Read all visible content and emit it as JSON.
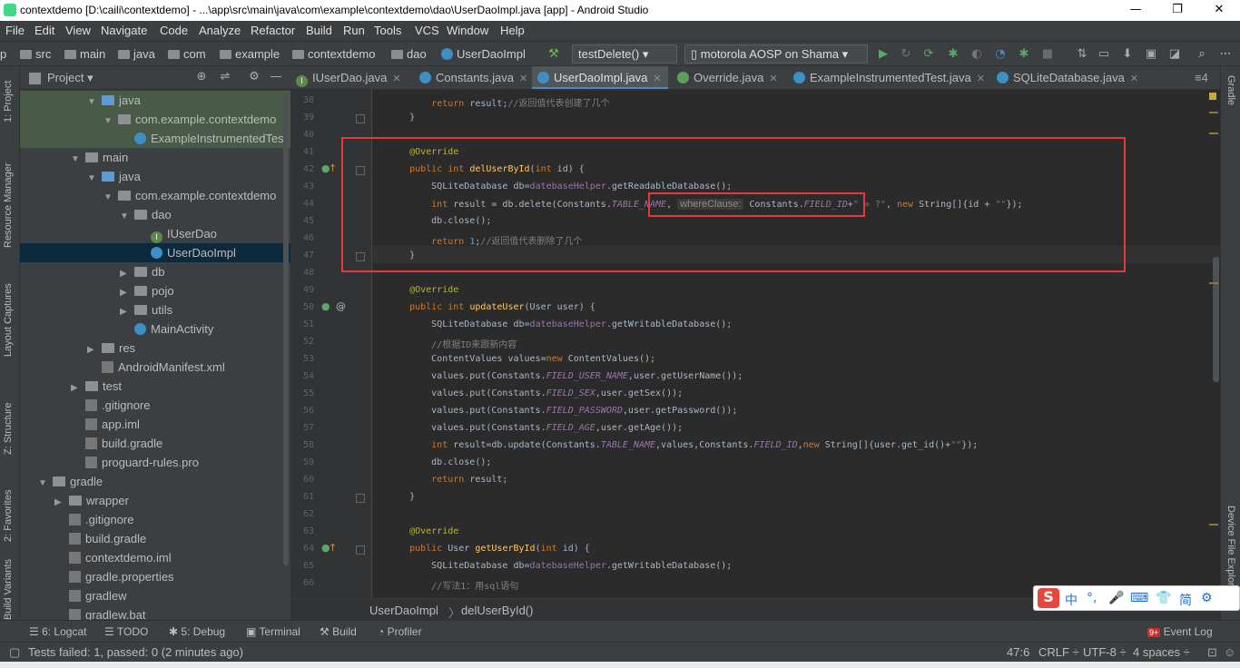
{
  "window": {
    "title": "contextdemo [D:\\caili\\contextdemo] - ...\\app\\src\\main\\java\\com\\example\\contextdemo\\dao\\UserDaoImpl.java [app] - Android Studio",
    "minimize": "—",
    "maximize": "❐",
    "close": "✕"
  },
  "menu": [
    "File",
    "Edit",
    "View",
    "Navigate",
    "Code",
    "Analyze",
    "Refactor",
    "Build",
    "Run",
    "Tools",
    "VCS",
    "Window",
    "Help"
  ],
  "nav": {
    "crumbs": [
      "p",
      "src",
      "main",
      "java",
      "com",
      "example",
      "contextdemo",
      "dao",
      "UserDaoImpl"
    ],
    "run_config": "testDelete()",
    "device": "motorola AOSP on Shama"
  },
  "project": {
    "title": "Project",
    "dropdown": "▾",
    "tree": [
      {
        "label": "java",
        "indent": 4,
        "icon": "folder-blue",
        "arrow": "▼",
        "state": "hl"
      },
      {
        "label": "com.example.contextdemo",
        "indent": 5,
        "icon": "folder",
        "arrow": "▼",
        "state": "hl"
      },
      {
        "label": "ExampleInstrumentedTest",
        "indent": 6,
        "icon": "class",
        "arrow": "",
        "state": "hl"
      },
      {
        "label": "main",
        "indent": 3,
        "icon": "folder",
        "arrow": "▼",
        "state": ""
      },
      {
        "label": "java",
        "indent": 4,
        "icon": "folder-blue",
        "arrow": "▼",
        "state": ""
      },
      {
        "label": "com.example.contextdemo",
        "indent": 5,
        "icon": "folder",
        "arrow": "▼",
        "state": ""
      },
      {
        "label": "dao",
        "indent": 6,
        "icon": "folder",
        "arrow": "▼",
        "state": ""
      },
      {
        "label": "IUserDao",
        "indent": 7,
        "icon": "interface",
        "arrow": "",
        "state": ""
      },
      {
        "label": "UserDaoImpl",
        "indent": 7,
        "icon": "class",
        "arrow": "",
        "state": "sel"
      },
      {
        "label": "db",
        "indent": 6,
        "icon": "folder",
        "arrow": "▶",
        "state": ""
      },
      {
        "label": "pojo",
        "indent": 6,
        "icon": "folder",
        "arrow": "▶",
        "state": ""
      },
      {
        "label": "utils",
        "indent": 6,
        "icon": "folder",
        "arrow": "▶",
        "state": ""
      },
      {
        "label": "MainActivity",
        "indent": 6,
        "icon": "class",
        "arrow": "",
        "state": ""
      },
      {
        "label": "res",
        "indent": 4,
        "icon": "folder",
        "arrow": "▶",
        "state": ""
      },
      {
        "label": "AndroidManifest.xml",
        "indent": 4,
        "icon": "file",
        "arrow": "",
        "state": ""
      },
      {
        "label": "test",
        "indent": 3,
        "icon": "folder",
        "arrow": "▶",
        "state": ""
      },
      {
        "label": ".gitignore",
        "indent": 3,
        "icon": "file",
        "arrow": "",
        "state": ""
      },
      {
        "label": "app.iml",
        "indent": 3,
        "icon": "file",
        "arrow": "",
        "state": ""
      },
      {
        "label": "build.gradle",
        "indent": 3,
        "icon": "file",
        "arrow": "",
        "state": ""
      },
      {
        "label": "proguard-rules.pro",
        "indent": 3,
        "icon": "file",
        "arrow": "",
        "state": ""
      },
      {
        "label": "gradle",
        "indent": 1,
        "icon": "folder",
        "arrow": "▼",
        "state": ""
      },
      {
        "label": "wrapper",
        "indent": 2,
        "icon": "folder",
        "arrow": "▶",
        "state": ""
      },
      {
        "label": ".gitignore",
        "indent": 2,
        "icon": "file",
        "arrow": "",
        "state": ""
      },
      {
        "label": "build.gradle",
        "indent": 2,
        "icon": "file",
        "arrow": "",
        "state": ""
      },
      {
        "label": "contextdemo.iml",
        "indent": 2,
        "icon": "file",
        "arrow": "",
        "state": ""
      },
      {
        "label": "gradle.properties",
        "indent": 2,
        "icon": "file",
        "arrow": "",
        "state": ""
      },
      {
        "label": "gradlew",
        "indent": 2,
        "icon": "file",
        "arrow": "",
        "state": ""
      },
      {
        "label": "gradlew.bat",
        "indent": 2,
        "icon": "file",
        "arrow": "",
        "state": ""
      }
    ]
  },
  "left_tools": [
    "1: Project",
    "Resource Manager",
    "Layout Captures",
    "Z: Structure",
    "2: Favorites",
    "Build Variants"
  ],
  "right_tools": [
    "Gradle",
    "Device File Explorer"
  ],
  "tabs": [
    {
      "label": "IUserDao.java",
      "icon": "interface"
    },
    {
      "label": "Constants.java",
      "icon": "class"
    },
    {
      "label": "UserDaoImpl.java",
      "icon": "class",
      "active": true
    },
    {
      "label": "Override.java",
      "icon": "annotation"
    },
    {
      "label": "ExampleInstrumentedTest.java",
      "icon": "class"
    },
    {
      "label": "SQLiteDatabase.java",
      "icon": "class"
    }
  ],
  "tabs_overflow": "≡4",
  "editor": {
    "hint": "whereClause:",
    "lines": [
      {
        "n": "38",
        "segs": [
          [
            "",
            "        "
          ],
          [
            "kw",
            "return "
          ],
          [
            "",
            "result;"
          ],
          [
            "cm",
            "//返回值代表创建了几个"
          ]
        ]
      },
      {
        "n": "39",
        "segs": [
          [
            "",
            "    }"
          ]
        ]
      },
      {
        "n": "40",
        "segs": []
      },
      {
        "n": "41",
        "segs": [
          [
            "an",
            "    @Override"
          ]
        ]
      },
      {
        "n": "42",
        "segs": [
          [
            "kw",
            "    public int "
          ],
          [
            "fn",
            "delUserById"
          ],
          [
            "",
            "("
          ],
          [
            "kw",
            "int "
          ],
          [
            "",
            "id) {"
          ]
        ]
      },
      {
        "n": "43",
        "segs": [
          [
            "",
            "        SQLiteDatabase db="
          ],
          [
            "mem",
            "datebaseHelper"
          ],
          [
            "",
            ".getReadableDatabase();"
          ]
        ]
      },
      {
        "n": "44",
        "segs": [
          [
            "kw",
            "        int "
          ],
          [
            "",
            "result = db.delete(Constants."
          ],
          [
            "fi",
            "TABLE_NAME"
          ],
          [
            "",
            ", "
          ],
          [
            "hint",
            "whereClause:"
          ],
          [
            "",
            " Constants."
          ],
          [
            "fi",
            "FIELD_ID"
          ],
          [
            "",
            "+"
          ],
          [
            "st",
            "\" = ?\""
          ],
          [
            "",
            ", "
          ],
          [
            "kw",
            "new "
          ],
          [
            "",
            "String[]{id + "
          ],
          [
            "st",
            "\"\""
          ],
          [
            "",
            "});"
          ]
        ]
      },
      {
        "n": "45",
        "segs": [
          [
            "",
            "        db.close();"
          ]
        ]
      },
      {
        "n": "46",
        "segs": [
          [
            "kw",
            "        return "
          ],
          [
            "num",
            "1"
          ],
          [
            "",
            ";"
          ],
          [
            "cm",
            "//返回值代表删除了几个"
          ]
        ]
      },
      {
        "n": "47",
        "segs": [
          [
            "",
            "    }"
          ]
        ]
      },
      {
        "n": "48",
        "segs": []
      },
      {
        "n": "49",
        "segs": [
          [
            "an",
            "    @Override"
          ]
        ]
      },
      {
        "n": "50",
        "segs": [
          [
            "kw",
            "    public int "
          ],
          [
            "fn",
            "updateUser"
          ],
          [
            "",
            "(User user) {"
          ]
        ]
      },
      {
        "n": "51",
        "segs": [
          [
            "",
            "        SQLiteDatabase db="
          ],
          [
            "mem",
            "datebaseHelper"
          ],
          [
            "",
            ".getWritableDatabase();"
          ]
        ]
      },
      {
        "n": "52",
        "segs": [
          [
            "cm",
            "        //根据ID来跟新内容"
          ]
        ]
      },
      {
        "n": "53",
        "segs": [
          [
            "",
            "        ContentValues values="
          ],
          [
            "kw",
            "new "
          ],
          [
            "",
            "ContentValues();"
          ]
        ]
      },
      {
        "n": "54",
        "segs": [
          [
            "",
            "        values.put(Constants."
          ],
          [
            "fi",
            "FIELD_USER_NAME"
          ],
          [
            "",
            ",user.getUserName());"
          ]
        ]
      },
      {
        "n": "55",
        "segs": [
          [
            "",
            "        values.put(Constants."
          ],
          [
            "fi",
            "FIELD_SEX"
          ],
          [
            "",
            ",user.getSex());"
          ]
        ]
      },
      {
        "n": "56",
        "segs": [
          [
            "",
            "        values.put(Constants."
          ],
          [
            "fi",
            "FIELD_PASSWORD"
          ],
          [
            "",
            ",user.getPassword());"
          ]
        ]
      },
      {
        "n": "57",
        "segs": [
          [
            "",
            "        values.put(Constants."
          ],
          [
            "fi",
            "FIELD_AGE"
          ],
          [
            "",
            ",user.getAge());"
          ]
        ]
      },
      {
        "n": "58",
        "segs": [
          [
            "kw",
            "        int "
          ],
          [
            "",
            "result=db.update(Constants."
          ],
          [
            "fi",
            "TABLE_NAME"
          ],
          [
            "",
            ",values,Constants."
          ],
          [
            "fi",
            "FIELD_ID"
          ],
          [
            "",
            ","
          ],
          [
            "kw",
            "new "
          ],
          [
            "",
            "String[]{user.get_id()+"
          ],
          [
            "st",
            "\"\""
          ],
          [
            "",
            "});"
          ]
        ]
      },
      {
        "n": "59",
        "segs": [
          [
            "",
            "        db.close();"
          ]
        ]
      },
      {
        "n": "60",
        "segs": [
          [
            "kw",
            "        return "
          ],
          [
            "",
            "result;"
          ]
        ]
      },
      {
        "n": "61",
        "segs": [
          [
            "",
            "    }"
          ]
        ]
      },
      {
        "n": "62",
        "segs": []
      },
      {
        "n": "63",
        "segs": [
          [
            "an",
            "    @Override"
          ]
        ]
      },
      {
        "n": "64",
        "segs": [
          [
            "kw",
            "    public "
          ],
          [
            "",
            "User "
          ],
          [
            "fn",
            "getUserById"
          ],
          [
            "",
            "("
          ],
          [
            "kw",
            "int "
          ],
          [
            "",
            "id) {"
          ]
        ]
      },
      {
        "n": "65",
        "segs": [
          [
            "",
            "        SQLiteDatabase db="
          ],
          [
            "mem",
            "datebaseHelper"
          ],
          [
            "",
            ".getWritableDatabase();"
          ]
        ]
      },
      {
        "n": "66",
        "segs": [
          [
            "cm",
            "        //写法1：用sql语句"
          ]
        ]
      }
    ]
  },
  "editor_crumbs": [
    "UserDaoImpl",
    "delUserById()"
  ],
  "bottom_tools": [
    "6: Logcat",
    "TODO",
    "5: Debug",
    "Terminal",
    "Build",
    "Profiler"
  ],
  "event_log": "Event Log",
  "event_badge": "9+",
  "status": {
    "message": "Tests failed: 1, passed: 0 (2 minutes ago)",
    "position": "47:6",
    "line_sep": "CRLF ÷",
    "encoding": "UTF-8 ÷",
    "indent": "4 spaces ÷"
  },
  "ime": [
    "S",
    "中",
    "°,",
    "🎤",
    "⌨",
    "👕",
    "简",
    "⚙"
  ],
  "colors": {
    "accent": "#4a88c7",
    "highlight_box": "#e23b3b"
  }
}
